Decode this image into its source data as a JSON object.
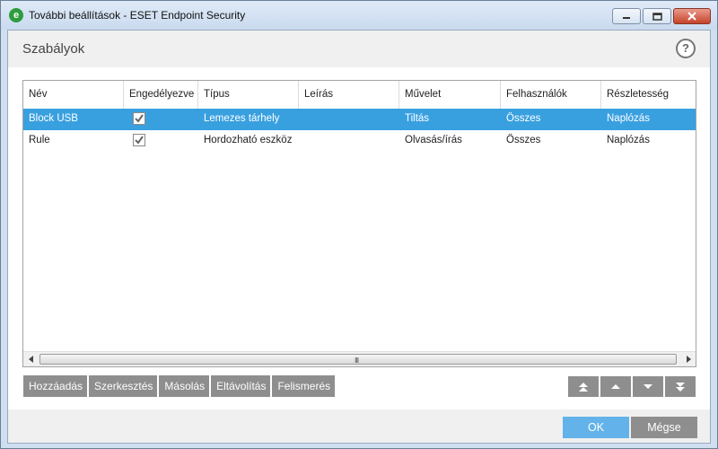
{
  "window": {
    "title": "További beállítások - ESET Endpoint Security",
    "app_icon_letter": "e"
  },
  "header": {
    "title": "Szabályok",
    "help_symbol": "?"
  },
  "table": {
    "columns": [
      "Név",
      "Engedélyezve",
      "Típus",
      "Leírás",
      "Művelet",
      "Felhasználók",
      "Részletesség"
    ],
    "rows": [
      {
        "name": "Block USB",
        "enabled": true,
        "type": "Lemezes tárhely",
        "description": "",
        "action": "Tiltás",
        "users": "Összes",
        "verbosity": "Naplózás",
        "selected": true
      },
      {
        "name": "Rule",
        "enabled": true,
        "type": "Hordozható eszköz",
        "description": "",
        "action": "Olvasás/írás",
        "users": "Összes",
        "verbosity": "Naplózás",
        "selected": false
      }
    ],
    "scroll_grip": "III"
  },
  "actions": {
    "add": "Hozzáadás",
    "edit": "Szerkesztés",
    "copy": "Másolás",
    "remove": "Eltávolítás",
    "detect": "Felismerés"
  },
  "footer": {
    "ok": "OK",
    "cancel": "Mégse"
  },
  "colors": {
    "selection": "#39a0e0",
    "button_gray": "#8e8e8e",
    "ok_blue": "#63b3ea",
    "brand_green": "#2f9c3e"
  }
}
